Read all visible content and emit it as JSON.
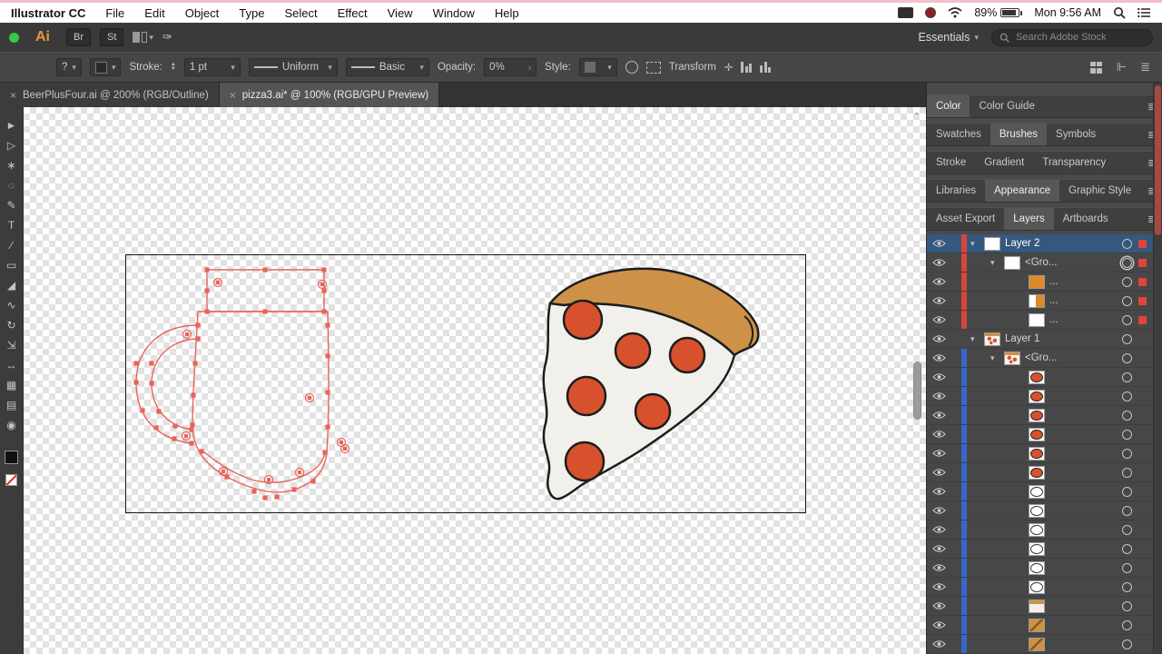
{
  "menubar": {
    "app_name": "Illustrator CC",
    "items": [
      "File",
      "Edit",
      "Object",
      "Type",
      "Select",
      "Effect",
      "View",
      "Window",
      "Help"
    ],
    "battery_percent": "89%",
    "clock": "Mon 9:56 AM"
  },
  "app_toolbar": {
    "ai_logo": "Ai",
    "bridge_button": "Br",
    "stock_button": "St",
    "workspace_selector": "Essentials",
    "stock_search_placeholder": "Search Adobe Stock"
  },
  "control_bar": {
    "tool_help": "?",
    "stroke_label": "Stroke:",
    "stroke_weight": "1 pt",
    "variable_width_profile": "Uniform",
    "brush_definition": "Basic",
    "opacity_label": "Opacity:",
    "opacity_value": "0%",
    "style_label": "Style:",
    "transform_label": "Transform"
  },
  "document_tabs": [
    {
      "label": "BeerPlusFour.ai @ 200% (RGB/Outline)",
      "active": false
    },
    {
      "label": "pizza3.ai* @ 100% (RGB/GPU Preview)",
      "active": true
    }
  ],
  "tools": [
    {
      "name": "selection-tool",
      "glyph": "►"
    },
    {
      "name": "direct-selection-tool",
      "glyph": "▷"
    },
    {
      "name": "magic-wand-tool",
      "glyph": "∗"
    },
    {
      "name": "lasso-tool",
      "glyph": "◌"
    },
    {
      "name": "pen-tool",
      "glyph": "✎"
    },
    {
      "name": "type-tool",
      "glyph": "T"
    },
    {
      "name": "line-segment-tool",
      "glyph": "∕"
    },
    {
      "name": "rectangle-tool",
      "glyph": "▭"
    },
    {
      "name": "paintbrush-tool",
      "glyph": "◢"
    },
    {
      "name": "pencil-tool",
      "glyph": "∿"
    },
    {
      "name": "rotate-tool",
      "glyph": "↻"
    },
    {
      "name": "scale-tool",
      "glyph": "⇲"
    },
    {
      "name": "width-tool",
      "glyph": "↔"
    },
    {
      "name": "mesh-tool",
      "glyph": "▦"
    },
    {
      "name": "gradient-tool",
      "glyph": "▤"
    },
    {
      "name": "zoom-tool",
      "glyph": "◉"
    }
  ],
  "right_panel": {
    "groups": [
      {
        "tabs": [
          {
            "label": "Color",
            "active": true
          },
          {
            "label": "Color Guide",
            "active": false
          }
        ]
      },
      {
        "tabs": [
          {
            "label": "Swatches",
            "active": false
          },
          {
            "label": "Brushes",
            "active": true
          },
          {
            "label": "Symbols",
            "active": false
          }
        ]
      },
      {
        "tabs": [
          {
            "label": "Stroke",
            "active": false
          },
          {
            "label": "Gradient",
            "active": false
          },
          {
            "label": "Transparency",
            "active": false
          }
        ]
      },
      {
        "tabs": [
          {
            "label": "Libraries",
            "active": false
          },
          {
            "label": "Appearance",
            "active": true
          },
          {
            "label": "Graphic Style",
            "active": false
          }
        ]
      },
      {
        "tabs": [
          {
            "label": "Asset Export",
            "active": false
          },
          {
            "label": "Layers",
            "active": true
          },
          {
            "label": "Artboards",
            "active": false
          }
        ]
      }
    ]
  },
  "layers": [
    {
      "label": "Layer 2",
      "indent": 0,
      "disclosure": true,
      "thumb": "white",
      "bar": "red",
      "selected": true,
      "target": "single",
      "selected_badge": true
    },
    {
      "label": "<Gro...",
      "indent": 1,
      "disclosure": true,
      "thumb": "white",
      "bar": "red",
      "target": "double",
      "selected_badge": true
    },
    {
      "label": "...",
      "indent": 2,
      "thumb": "orange",
      "bar": "red",
      "target": "single",
      "selected_badge": true
    },
    {
      "label": "...",
      "indent": 2,
      "thumb": "half",
      "bar": "red",
      "target": "single",
      "selected_badge": true
    },
    {
      "label": "...",
      "indent": 2,
      "thumb": "white",
      "bar": "red",
      "target": "single",
      "selected_badge": true
    },
    {
      "label": "Layer 1",
      "indent": 0,
      "disclosure": true,
      "thumb": "pizza",
      "bar": "none",
      "target": "single"
    },
    {
      "label": "<Gro...",
      "indent": 1,
      "disclosure": true,
      "thumb": "pizza",
      "bar": "blue",
      "target": "single"
    },
    {
      "label": "",
      "indent": 2,
      "thumb": "pep",
      "bar": "blue",
      "target": "single"
    },
    {
      "label": "",
      "indent": 2,
      "thumb": "pep",
      "bar": "blue",
      "target": "single"
    },
    {
      "label": "",
      "indent": 2,
      "thumb": "pep",
      "bar": "blue",
      "target": "single"
    },
    {
      "label": "",
      "indent": 2,
      "thumb": "pep",
      "bar": "blue",
      "target": "single"
    },
    {
      "label": "",
      "indent": 2,
      "thumb": "pep",
      "bar": "blue",
      "target": "single"
    },
    {
      "label": "",
      "indent": 2,
      "thumb": "pep",
      "bar": "blue",
      "target": "single"
    },
    {
      "label": "",
      "indent": 2,
      "thumb": "ring",
      "bar": "blue",
      "target": "single"
    },
    {
      "label": "",
      "indent": 2,
      "thumb": "ring",
      "bar": "blue",
      "target": "single"
    },
    {
      "label": "",
      "indent": 2,
      "thumb": "ring",
      "bar": "blue",
      "target": "single"
    },
    {
      "label": "",
      "indent": 2,
      "thumb": "ring",
      "bar": "blue",
      "target": "single"
    },
    {
      "label": "",
      "indent": 2,
      "thumb": "ring",
      "bar": "blue",
      "target": "single"
    },
    {
      "label": "",
      "indent": 2,
      "thumb": "ring",
      "bar": "blue",
      "target": "single"
    },
    {
      "label": "",
      "indent": 2,
      "thumb": "cheese",
      "bar": "blue",
      "target": "single"
    },
    {
      "label": "",
      "indent": 2,
      "thumb": "crust",
      "bar": "blue",
      "target": "single"
    },
    {
      "label": "",
      "indent": 2,
      "thumb": "crust",
      "bar": "blue",
      "target": "single"
    }
  ],
  "artwork": {
    "crust": "#cd9148",
    "cheese": "#f2f0ea",
    "pepperoni": "#d8512d",
    "outline": "#1d1d1d",
    "selection": "#e8635b"
  },
  "colors": {
    "selected_row": "#35587d",
    "layer_bar_red": "#d9453c",
    "layer_bar_blue": "#3667c9",
    "selection_badge": "#e0443a",
    "fill_sw": "#111111"
  }
}
